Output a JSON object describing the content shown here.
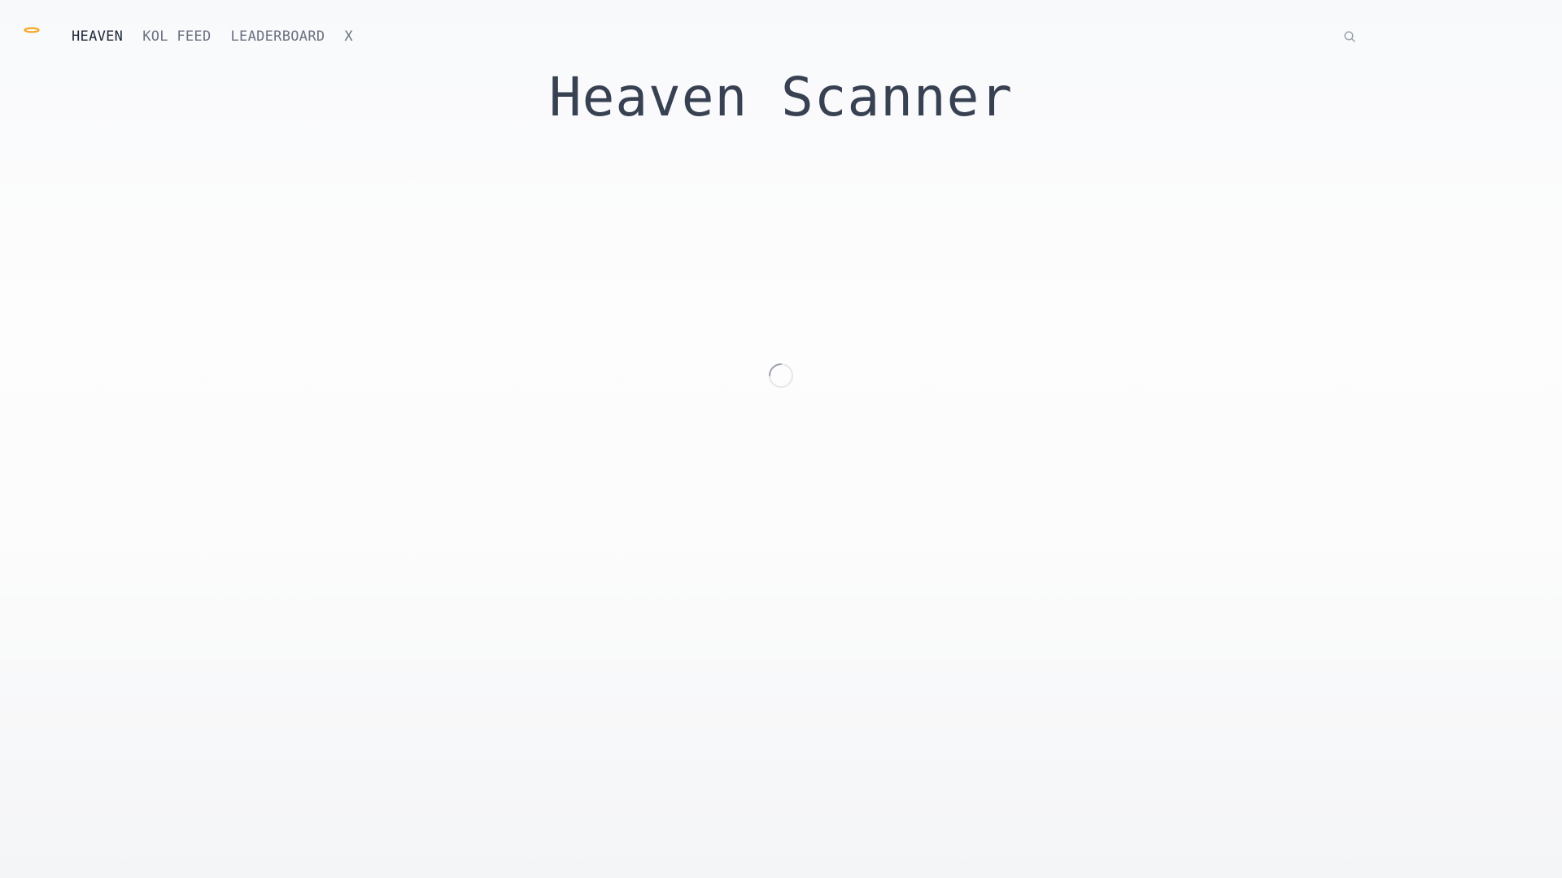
{
  "header": {
    "logo_icon": "halo-icon",
    "nav": {
      "items": [
        {
          "label": "HEAVEN",
          "active": true
        },
        {
          "label": "KOL FEED",
          "active": false
        },
        {
          "label": "LEADERBOARD",
          "active": false
        },
        {
          "label": "X",
          "active": false
        }
      ]
    },
    "search_icon": "search-icon"
  },
  "main": {
    "title": "Heaven Scanner",
    "loading_icon": "loading-spinner-icon"
  },
  "colors": {
    "accent": "#f5a623",
    "title_text": "#374151",
    "nav_active": "#1f2937",
    "nav_inactive": "#6b7280",
    "spinner": "#9ca3af"
  }
}
